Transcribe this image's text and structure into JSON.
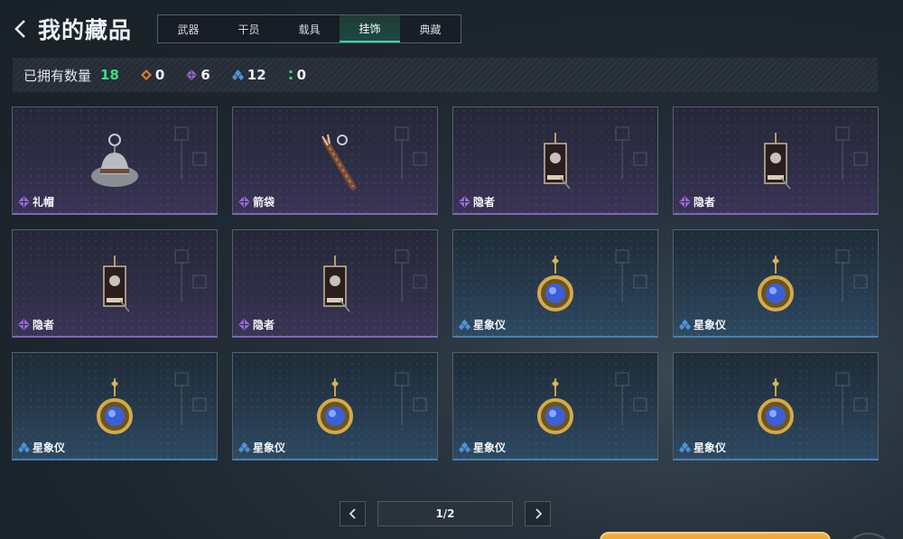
{
  "header": {
    "title": "我的藏品"
  },
  "tabs": [
    {
      "label": "武器",
      "active": false
    },
    {
      "label": "干员",
      "active": false
    },
    {
      "label": "载具",
      "active": false
    },
    {
      "label": "挂饰",
      "active": true
    },
    {
      "label": "典藏",
      "active": false
    }
  ],
  "stats": {
    "label": "已拥有数量",
    "total": "18",
    "orange_count": "0",
    "purple_count": "6",
    "blue_count": "12",
    "green_count": "0"
  },
  "colors": {
    "orange": "#d97a2b",
    "purple": "#9a6ad8",
    "blue": "#4f93d4",
    "green": "#2fd47a",
    "accent_total": "#36e07d"
  },
  "items": [
    {
      "name": "礼帽",
      "rarity": "purple",
      "icon": "hat-charm-icon"
    },
    {
      "name": "箭袋",
      "rarity": "purple",
      "icon": "quiver-charm-icon"
    },
    {
      "name": "隐者",
      "rarity": "purple",
      "icon": "tarot-card-charm-icon"
    },
    {
      "name": "隐者",
      "rarity": "purple",
      "icon": "tarot-card-charm-icon"
    },
    {
      "name": "隐者",
      "rarity": "purple",
      "icon": "tarot-card-charm-icon"
    },
    {
      "name": "隐者",
      "rarity": "purple",
      "icon": "tarot-card-charm-icon"
    },
    {
      "name": "星象仪",
      "rarity": "blue",
      "icon": "astrolabe-charm-icon"
    },
    {
      "name": "星象仪",
      "rarity": "blue",
      "icon": "astrolabe-charm-icon"
    },
    {
      "name": "星象仪",
      "rarity": "blue",
      "icon": "astrolabe-charm-icon"
    },
    {
      "name": "星象仪",
      "rarity": "blue",
      "icon": "astrolabe-charm-icon"
    },
    {
      "name": "星象仪",
      "rarity": "blue",
      "icon": "astrolabe-charm-icon"
    },
    {
      "name": "星象仪",
      "rarity": "blue",
      "icon": "astrolabe-charm-icon"
    }
  ],
  "pagination": {
    "page_text": "1/2"
  }
}
